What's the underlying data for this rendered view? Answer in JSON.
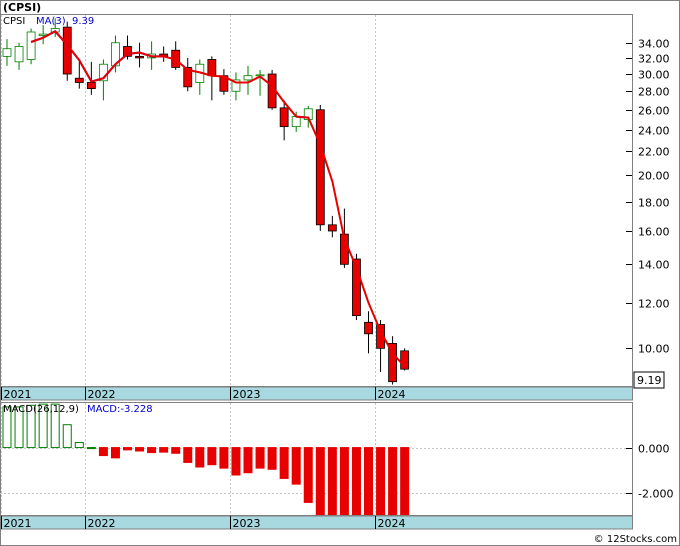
{
  "chart_title": "(CPSI)",
  "copyright": "© 12Stocks.com",
  "last_price_label": "9.19",
  "colors": {
    "up": "#008000",
    "down": "#e80000",
    "ma3": "#e80000",
    "ma_legend": "#0000cc",
    "axis_band": "#a8d8e0"
  },
  "chart_data": [
    {
      "type": "candlestick",
      "symbol": "CPSI",
      "legend": {
        "ticker": "CPSI",
        "ma_label": "MA(3)",
        "ma_value": "9.39"
      },
      "y_scale": "log",
      "ylim": [
        8.6,
        38.0
      ],
      "y_ticks": [
        10,
        12,
        14,
        16,
        18,
        20,
        22,
        24,
        26,
        28,
        30,
        32,
        34
      ],
      "y_tick_labels": [
        "10.00",
        "12.00",
        "14.00",
        "16.00",
        "18.00",
        "20.00",
        "22.00",
        "24.00",
        "26.00",
        "28.00",
        "30.00",
        "32.00",
        "34.00"
      ],
      "x_year_labels": [
        "2021",
        "2022",
        "2023",
        "2024"
      ],
      "x_year_at_index": [
        0,
        7,
        19,
        31
      ],
      "ohlc": [
        {
          "o": 32.2,
          "h": 34.5,
          "l": 31.0,
          "c": 33.2
        },
        {
          "o": 31.5,
          "h": 34.0,
          "l": 30.5,
          "c": 33.5
        },
        {
          "o": 31.8,
          "h": 36.0,
          "l": 31.2,
          "c": 35.5
        },
        {
          "o": 35.0,
          "h": 36.5,
          "l": 33.8,
          "c": 35.2
        },
        {
          "o": 35.5,
          "h": 37.5,
          "l": 34.8,
          "c": 36.0
        },
        {
          "o": 36.2,
          "h": 37.0,
          "l": 29.2,
          "c": 30.0
        },
        {
          "o": 29.5,
          "h": 31.5,
          "l": 28.3,
          "c": 29.0
        },
        {
          "o": 29.0,
          "h": 31.5,
          "l": 27.6,
          "c": 28.3
        },
        {
          "o": 29.2,
          "h": 31.8,
          "l": 27.0,
          "c": 31.2
        },
        {
          "o": 31.0,
          "h": 35.0,
          "l": 30.2,
          "c": 34.0
        },
        {
          "o": 33.5,
          "h": 35.0,
          "l": 31.8,
          "c": 32.2
        },
        {
          "o": 32.2,
          "h": 34.0,
          "l": 30.8,
          "c": 32.0
        },
        {
          "o": 32.0,
          "h": 34.2,
          "l": 30.5,
          "c": 32.5
        },
        {
          "o": 32.5,
          "h": 33.5,
          "l": 31.5,
          "c": 32.2
        },
        {
          "o": 33.0,
          "h": 34.2,
          "l": 30.5,
          "c": 30.8
        },
        {
          "o": 30.8,
          "h": 32.0,
          "l": 28.0,
          "c": 28.5
        },
        {
          "o": 29.0,
          "h": 31.8,
          "l": 27.6,
          "c": 31.2
        },
        {
          "o": 31.8,
          "h": 32.2,
          "l": 27.0,
          "c": 29.8
        },
        {
          "o": 29.8,
          "h": 30.6,
          "l": 27.6,
          "c": 28.0
        },
        {
          "o": 28.0,
          "h": 30.2,
          "l": 27.0,
          "c": 29.3
        },
        {
          "o": 29.3,
          "h": 31.0,
          "l": 27.6,
          "c": 29.8
        },
        {
          "o": 29.8,
          "h": 30.5,
          "l": 27.5,
          "c": 29.9
        },
        {
          "o": 30.0,
          "h": 30.5,
          "l": 26.0,
          "c": 26.2
        },
        {
          "o": 26.2,
          "h": 27.0,
          "l": 23.0,
          "c": 24.3
        },
        {
          "o": 24.3,
          "h": 25.8,
          "l": 23.8,
          "c": 25.3
        },
        {
          "o": 25.0,
          "h": 26.4,
          "l": 24.2,
          "c": 26.1
        },
        {
          "o": 26.0,
          "h": 26.5,
          "l": 16.0,
          "c": 16.4
        },
        {
          "o": 16.4,
          "h": 17.0,
          "l": 15.6,
          "c": 16.0
        },
        {
          "o": 15.8,
          "h": 17.5,
          "l": 13.8,
          "c": 14.0
        },
        {
          "o": 14.3,
          "h": 14.6,
          "l": 11.2,
          "c": 11.4
        },
        {
          "o": 11.1,
          "h": 11.6,
          "l": 9.8,
          "c": 10.6
        },
        {
          "o": 11.0,
          "h": 11.2,
          "l": 9.1,
          "c": 10.0
        },
        {
          "o": 10.2,
          "h": 10.5,
          "l": 8.65,
          "c": 8.75
        },
        {
          "o": 9.9,
          "h": 10.0,
          "l": 9.15,
          "c": 9.2
        }
      ],
      "ma3": [
        null,
        null,
        34.1,
        34.7,
        35.6,
        33.7,
        31.7,
        29.1,
        29.5,
        31.2,
        32.5,
        32.7,
        32.2,
        32.2,
        31.8,
        30.5,
        30.2,
        29.8,
        29.7,
        29.0,
        29.0,
        29.7,
        28.6,
        26.8,
        25.3,
        25.2,
        22.6,
        19.5,
        15.5,
        13.8,
        12.0,
        10.7,
        9.8,
        9.3
      ]
    },
    {
      "type": "bar",
      "legend": {
        "label": "MACD(26,12,9)",
        "value_label": "MACD:-3.228"
      },
      "ylim": [
        -2.95,
        1.95
      ],
      "y_ticks": [
        0,
        -2
      ],
      "y_tick_labels": [
        "0.000",
        "-2.000"
      ],
      "x_year_labels": [
        "2021",
        "2022",
        "2023",
        "2024"
      ],
      "x_year_at_index": [
        0,
        7,
        19,
        31
      ],
      "values": [
        1.78,
        1.78,
        1.85,
        1.9,
        1.9,
        1.0,
        0.22,
        0.0,
        -0.35,
        -0.45,
        -0.1,
        -0.15,
        -0.22,
        -0.2,
        -0.25,
        -0.65,
        -0.85,
        -0.75,
        -0.9,
        -1.2,
        -1.1,
        -0.9,
        -0.95,
        -1.35,
        -1.6,
        -2.4,
        -3.1,
        -3.8,
        -4.4,
        -4.1,
        -3.9,
        -3.5,
        -3.3,
        -3.228
      ]
    }
  ]
}
